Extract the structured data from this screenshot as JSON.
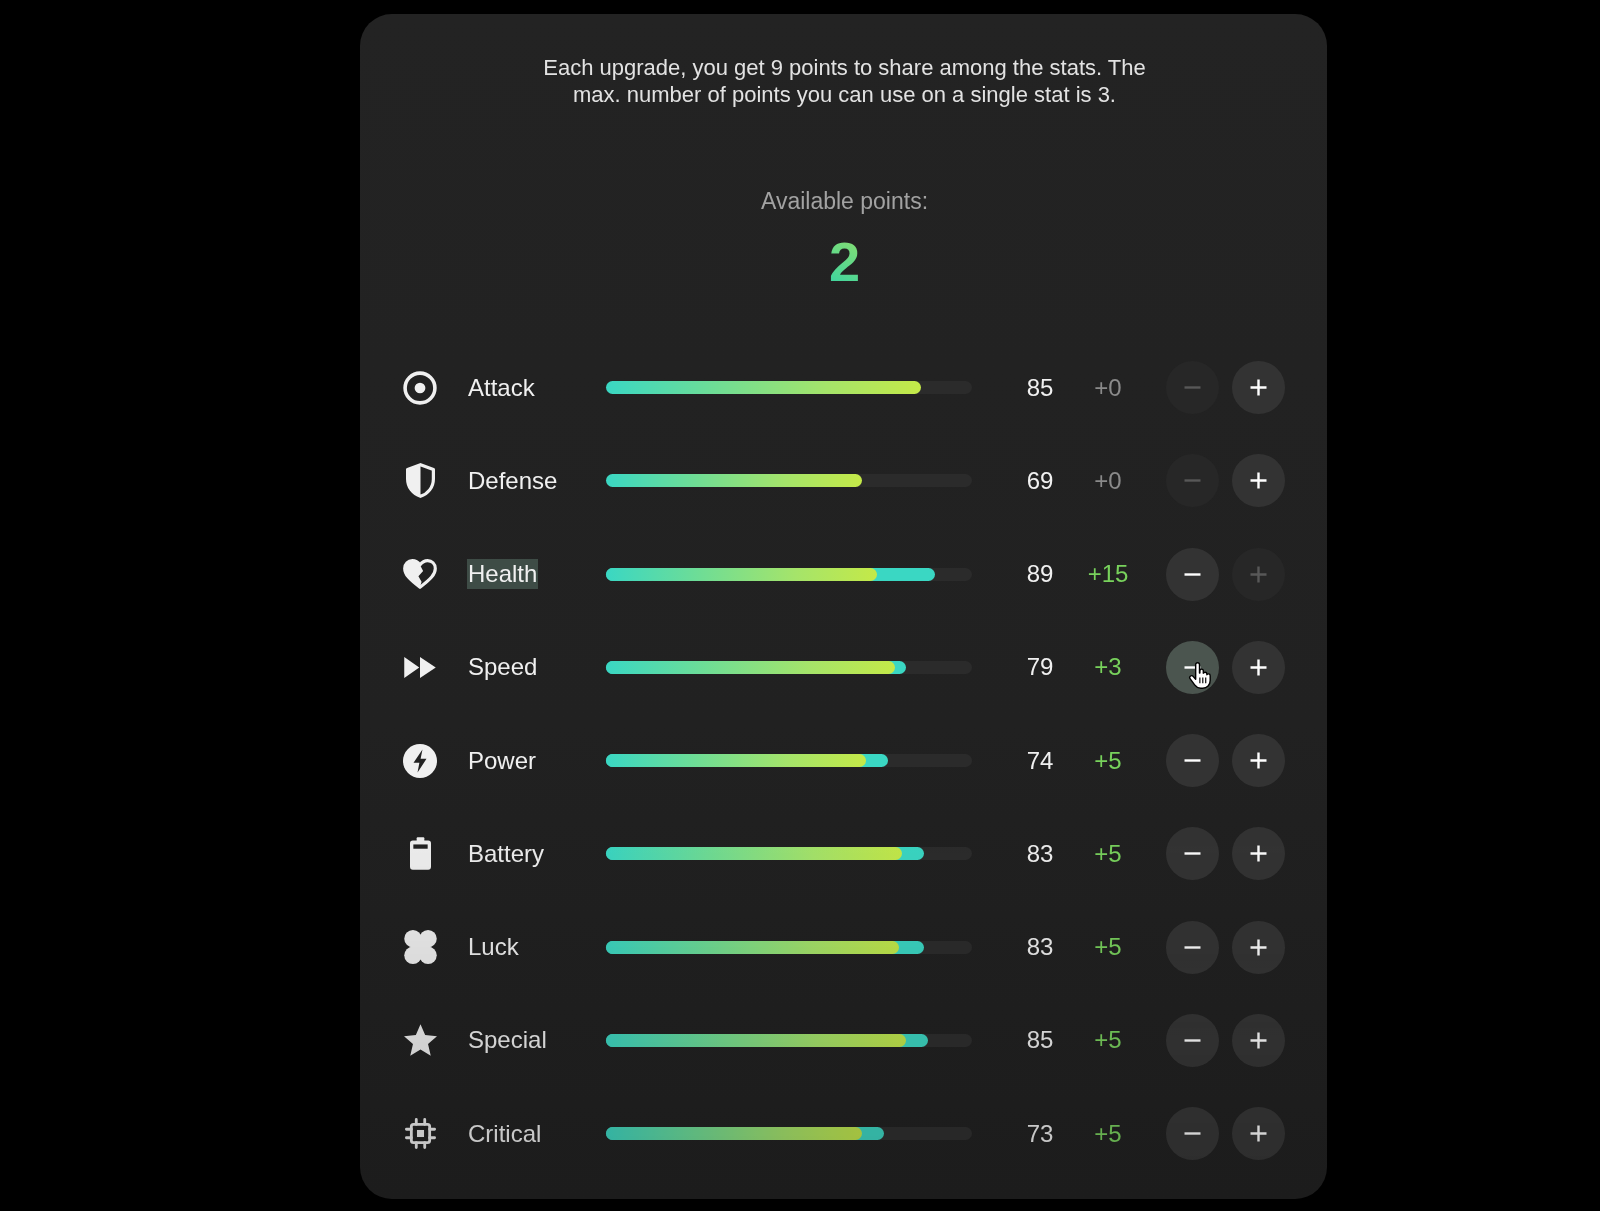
{
  "intro": "Each upgrade, you get 9 points to share among the stats. The max. number of points you can use on a single stat is 3.",
  "available": {
    "label": "Available points:",
    "value": "2"
  },
  "stats": [
    {
      "name": "Attack",
      "highlighted": false,
      "bar": {
        "level": 0.86
      },
      "value": "85",
      "bonus": {
        "text": "+0",
        "active": false
      },
      "decrease": {
        "disabled": true,
        "hovered": false
      },
      "increase": {
        "disabled": false,
        "hovered": false
      }
    },
    {
      "name": "Defense",
      "highlighted": false,
      "bar": {
        "level": 0.7
      },
      "value": "69",
      "bonus": {
        "text": "+0",
        "active": false
      },
      "decrease": {
        "disabled": true,
        "hovered": false
      },
      "increase": {
        "disabled": false,
        "hovered": false
      }
    },
    {
      "name": "Health",
      "highlighted": true,
      "bar": {
        "level": 0.74
      },
      "boosted_bar": {
        "level": 0.9
      },
      "value": "89",
      "bonus": {
        "text": "+15",
        "active": true
      },
      "decrease": {
        "disabled": false,
        "hovered": false
      },
      "increase": {
        "disabled": true,
        "hovered": false
      }
    },
    {
      "name": "Speed",
      "highlighted": false,
      "bar": {
        "level": 0.79
      },
      "boosted_bar": {
        "level": 0.82
      },
      "value": "79",
      "bonus": {
        "text": "+3",
        "active": true
      },
      "decrease": {
        "disabled": false,
        "hovered": true
      },
      "increase": {
        "disabled": false,
        "hovered": false
      }
    },
    {
      "name": "Power",
      "highlighted": false,
      "bar": {
        "level": 0.71
      },
      "boosted_bar": {
        "level": 0.77
      },
      "value": "74",
      "bonus": {
        "text": "+5",
        "active": true
      },
      "decrease": {
        "disabled": false,
        "hovered": false
      },
      "increase": {
        "disabled": false,
        "hovered": false
      }
    },
    {
      "name": "Battery",
      "highlighted": false,
      "bar": {
        "level": 0.81
      },
      "boosted_bar": {
        "level": 0.87
      },
      "value": "83",
      "bonus": {
        "text": "+5",
        "active": true
      },
      "decrease": {
        "disabled": false,
        "hovered": false
      },
      "increase": {
        "disabled": false,
        "hovered": false
      }
    },
    {
      "name": "Luck",
      "highlighted": false,
      "bar": {
        "level": 0.8
      },
      "boosted_bar": {
        "level": 0.87
      },
      "value": "83",
      "bonus": {
        "text": "+5",
        "active": true
      },
      "decrease": {
        "disabled": false,
        "hovered": false
      },
      "increase": {
        "disabled": false,
        "hovered": false
      }
    },
    {
      "name": "Special",
      "highlighted": false,
      "bar": {
        "level": 0.82
      },
      "boosted_bar": {
        "level": 0.88
      },
      "value": "85",
      "bonus": {
        "text": "+5",
        "active": true
      },
      "decrease": {
        "disabled": false,
        "hovered": false
      },
      "increase": {
        "disabled": false,
        "hovered": false
      }
    },
    {
      "name": "Critical",
      "highlighted": false,
      "bar": {
        "level": 0.7
      },
      "boosted_bar": {
        "level": 0.76
      },
      "value": "73",
      "bonus": {
        "text": "+5",
        "active": true
      },
      "decrease": {
        "disabled": false,
        "hovered": false
      },
      "increase": {
        "disabled": false,
        "hovered": false
      }
    }
  ]
}
